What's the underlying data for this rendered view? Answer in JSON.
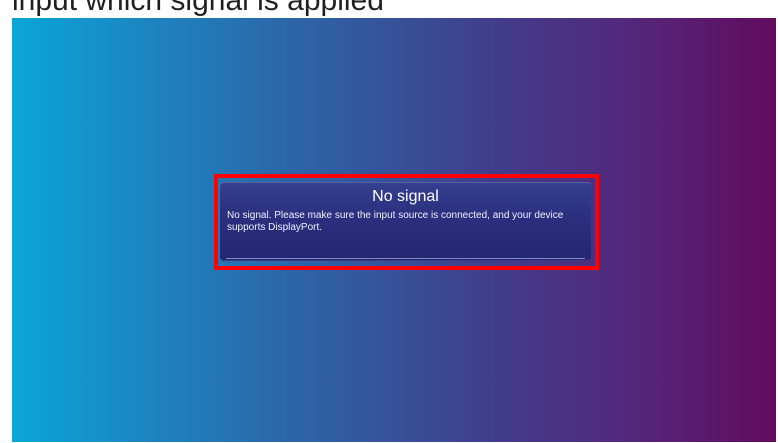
{
  "top_caption": "input which signal is applied",
  "dialog": {
    "title": "No signal",
    "message": "No signal. Please make sure the input source is connected, and your device supports DisplayPort."
  },
  "colors": {
    "highlight": "#ff0000",
    "gradient_left": "#0aa6d6",
    "gradient_right": "#610b5e",
    "dialog_bg": "#2b2f7e"
  }
}
